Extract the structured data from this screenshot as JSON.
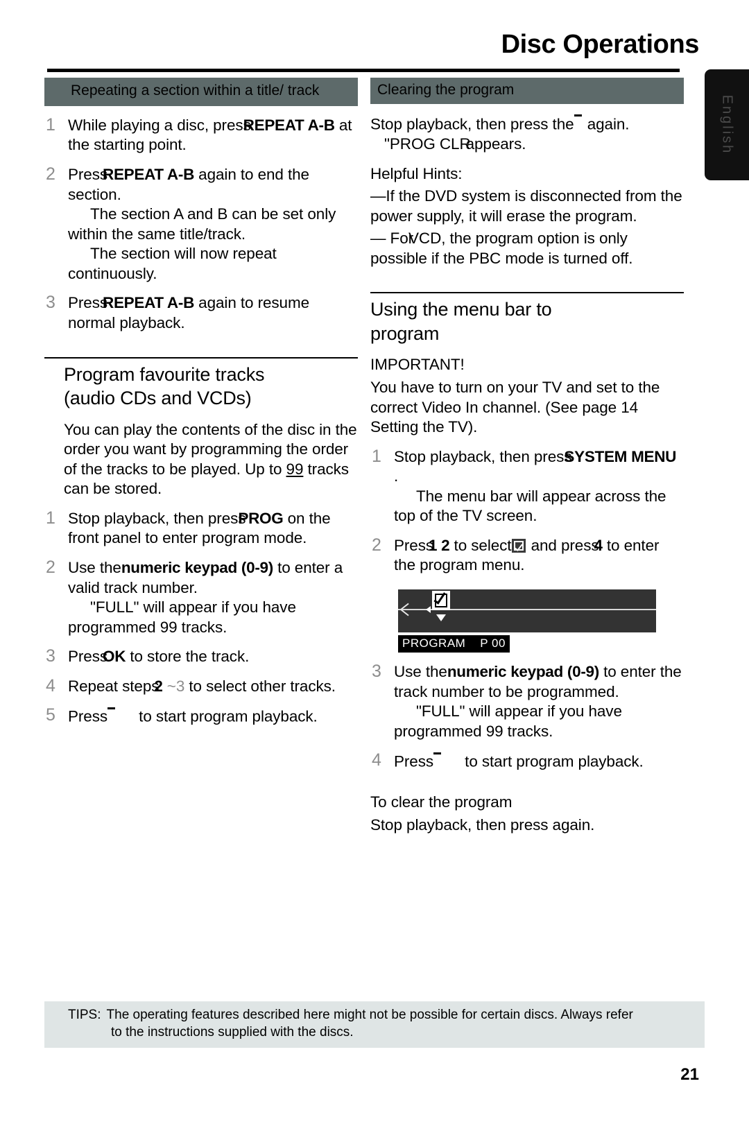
{
  "header": {
    "title": "Disc Operations"
  },
  "side_tab": {
    "label": "English",
    "color": "#111111"
  },
  "colors": {
    "banner_bg": "#5d6a6a",
    "tips_bg": "#dfe5e5",
    "menu_bar_bg": "#333333",
    "step_number": "#8d8d8d"
  },
  "left_column": {
    "banner": "Repeating a section within a title/ track",
    "steps": [
      {
        "num": "1",
        "parts": [
          {
            "t": "While playing a disc, press",
            "style": "normal"
          },
          {
            "t": "REPEAT A-B",
            "style": "bold-collide"
          },
          {
            "t": " at the starting point.",
            "style": "normal"
          }
        ]
      },
      {
        "num": "2",
        "parts": [
          {
            "t": "Press",
            "style": "normal"
          },
          {
            "t": "REPEAT A-B",
            "style": "bold"
          },
          {
            "t": " again to end the section.",
            "style": "normal"
          }
        ],
        "notes": [
          "The section A and B can be set only within the same title/track.",
          "The section will now repeat continuously."
        ]
      },
      {
        "num": "3",
        "parts": [
          {
            "t": "Press",
            "style": "normal"
          },
          {
            "t": "REPEAT A-B",
            "style": "bold"
          },
          {
            "t": " again to resume normal playback.",
            "style": "normal"
          }
        ]
      }
    ],
    "heading2_line1": "Program favourite tracks",
    "heading2_line2": "(audio CDs and VCDs)",
    "intro_a": "You can play the contents of the disc in the order you want",
    "intro_b": " by programming the order of the tracks to be played. Up to ",
    "intro_99": "99",
    "intro_c": " tracks can be stored.",
    "steps2": [
      {
        "num": "1",
        "a": "Stop playback, then press",
        "b": "PROG",
        "c": " on the front panel to enter program mode."
      },
      {
        "num": "2",
        "a": "Use the",
        "b": "numeric keypad (0-9)",
        "c": " to enter a valid track number.",
        "note": "\"FULL\" will appear if you have programmed 99 tracks."
      },
      {
        "num": "3",
        "a": "Press",
        "b": "OK",
        "c": " to store the track."
      },
      {
        "num": "4",
        "a": "Repeat steps",
        "b": "2",
        "c": " ~",
        "d": "3",
        "e": " to select other tracks."
      },
      {
        "num": "5",
        "a": "Press",
        "b": "",
        "c": " to start program playback."
      }
    ]
  },
  "right_column": {
    "banner": "Clearing the program",
    "clear_line1_a": "Stop playback, then press the",
    "clear_line1_b": " again.",
    "clear_line2_a": "\"PROG CLR",
    "clear_line2_b": "appears.",
    "hints_title": "Helpful Hints:",
    "hints": [
      "—If the DVD system is disconnected from the power supply, it will erase the program.",
      "—  For",
      "VCD, the program option is only possible if the PBC mode is turned off."
    ],
    "heading_line1": "Using the menu bar to",
    "heading_line2": "program",
    "important_title": "IMPORTANT!",
    "important_body": "You have to turn on your TV and set to the correct Video In channel.    (See page 14 Setting the TV).",
    "steps": [
      {
        "num": "1",
        "a": "Stop playback, then press",
        "b": "SYSTEM MENU",
        "c": " .",
        "note": "The menu bar will appear across the top of the TV screen."
      },
      {
        "num": "2",
        "a": "Press",
        "b": "1",
        "c": " 2",
        "d": " to select",
        "e": " and press",
        "f": "4",
        "g": " to enter the program menu."
      },
      {
        "num": "3",
        "a": "Use the",
        "b": "numeric keypad (0-9)",
        "c": " to enter the track number to be programmed.",
        "note": "\"FULL\" will appear if you have programmed 99 tracks."
      },
      {
        "num": "4",
        "a": "Press",
        "b": "",
        "c": " to start program playback."
      }
    ],
    "menu_graphic_label": "PROGRAM    P 00",
    "clear_heading": "To  clear the program",
    "clear_footer": "Stop playback, then press  again."
  },
  "footer": {
    "tips_label": "TIPS:",
    "tips_line1": "The operating features described here might not be possible for certain discs.  Always refer",
    "tips_line2": "to the instructions supplied with the discs.",
    "page_number": "21"
  }
}
